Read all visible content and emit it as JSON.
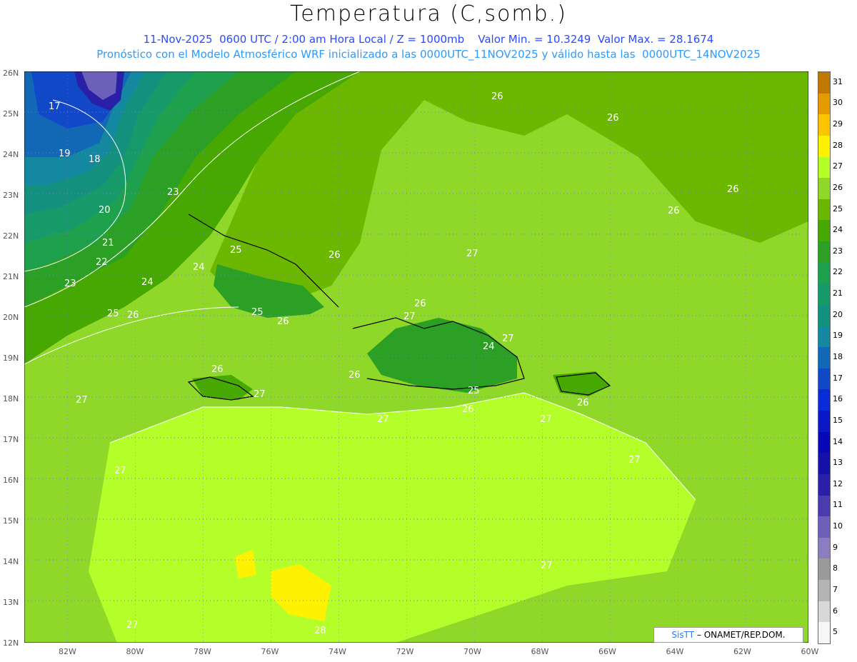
{
  "header": {
    "title": "Temperatura (C,somb.)",
    "subtitle_1": "11-Nov-2025  0600 UTC / 2:00 am Hora Local / Z = 1000mb    Valor Min. = 10.3249  Valor Max. = 28.1674",
    "subtitle_2": "Pronóstico con el Modelo Atmosférico WRF inicializado a las 0000UTC_11NOV2025 y válido hasta las  0000UTC_14NOV2025"
  },
  "map": {
    "lat_labels": [
      "26N",
      "25N",
      "24N",
      "23N",
      "22N",
      "21N",
      "20N",
      "19N",
      "18N",
      "17N",
      "16N",
      "15N",
      "14N",
      "13N",
      "12N"
    ],
    "lon_labels": [
      "82W",
      "80W",
      "78W",
      "76W",
      "74W",
      "72W",
      "70W",
      "68W",
      "66W",
      "64W",
      "62W",
      "60W"
    ],
    "contour_labels": [
      "17",
      "18",
      "19",
      "20",
      "21",
      "22",
      "23",
      "24",
      "25",
      "26",
      "27",
      "28"
    ]
  },
  "legend": {
    "values": [
      "31",
      "30",
      "29",
      "28",
      "27",
      "26",
      "25",
      "24",
      "23",
      "22",
      "21",
      "20",
      "19",
      "18",
      "17",
      "16",
      "15",
      "14",
      "13",
      "12",
      "11",
      "10",
      "9",
      "8",
      "7",
      "6",
      "5"
    ],
    "colors": [
      "#c07800",
      "#e39b00",
      "#ffc400",
      "#fff200",
      "#b4ff2a",
      "#8fd82a",
      "#6cb800",
      "#46a800",
      "#2ba025",
      "#1ea04c",
      "#179a6a",
      "#14907f",
      "#1388a0",
      "#1268b4",
      "#1048c8",
      "#0a2cd6",
      "#0a18c8",
      "#0808b4",
      "#1410a8",
      "#2a20a8",
      "#4a3cae",
      "#6c60b8",
      "#8c7cc0",
      "#9a9a9a",
      "#b4b4b4",
      "#d8d8d8",
      "#f6f6f6"
    ]
  },
  "credit": {
    "brand": "SisTT",
    "text": " – ONAMET/REP.DOM."
  }
}
